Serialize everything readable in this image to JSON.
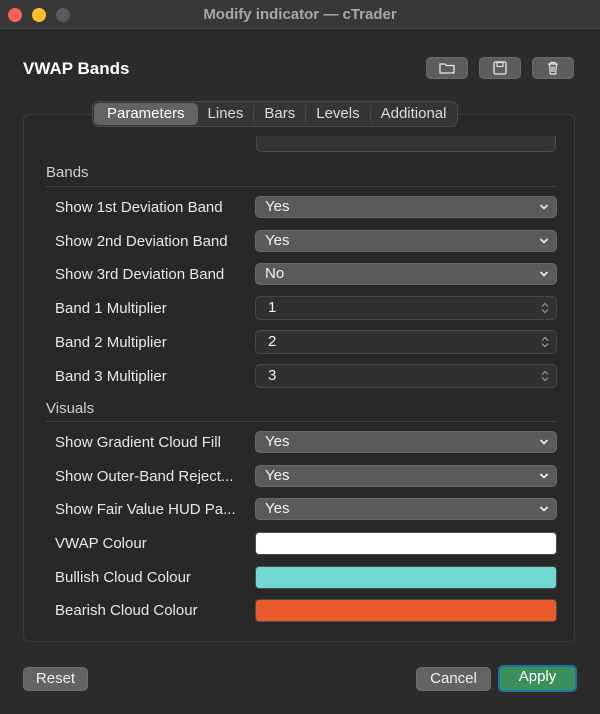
{
  "window": {
    "title": "Modify indicator — cTrader"
  },
  "indicator": {
    "name": "VWAP Bands"
  },
  "header_icons": [
    "folder-icon",
    "save-icon",
    "trash-icon"
  ],
  "tabs": [
    {
      "label": "Parameters",
      "active": true
    },
    {
      "label": "Lines",
      "active": false
    },
    {
      "label": "Bars",
      "active": false
    },
    {
      "label": "Levels",
      "active": false
    },
    {
      "label": "Additional",
      "active": false
    }
  ],
  "sections": {
    "bands": "Bands",
    "visuals": "Visuals"
  },
  "bands": {
    "show1": {
      "label": "Show 1st Deviation Band",
      "value": "Yes"
    },
    "show2": {
      "label": "Show 2nd Deviation Band",
      "value": "Yes"
    },
    "show3": {
      "label": "Show 3rd Deviation Band",
      "value": "No"
    },
    "mult1": {
      "label": "Band 1 Multiplier",
      "value": "1"
    },
    "mult2": {
      "label": "Band 2 Multiplier",
      "value": "2"
    },
    "mult3": {
      "label": "Band 3 Multiplier",
      "value": "3"
    }
  },
  "visuals": {
    "gradient": {
      "label": "Show Gradient Cloud Fill",
      "value": "Yes"
    },
    "reject": {
      "label": "Show Outer-Band Reject...",
      "value": "Yes"
    },
    "hud": {
      "label": "Show Fair Value HUD Pa...",
      "value": "Yes"
    },
    "vwap_colour": {
      "label": "VWAP Colour",
      "color": "#ffffff"
    },
    "bullish_colour": {
      "label": "Bullish Cloud Colour",
      "color": "#72d9d0"
    },
    "bearish_colour": {
      "label": "Bearish Cloud Colour",
      "color": "#eb5a2d"
    }
  },
  "footer": {
    "reset": "Reset",
    "cancel": "Cancel",
    "apply": "Apply"
  }
}
